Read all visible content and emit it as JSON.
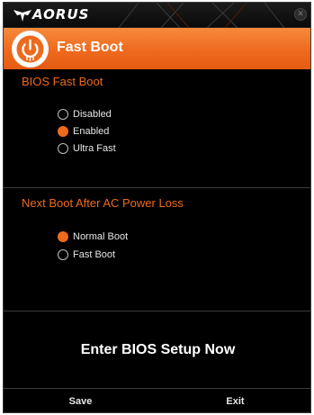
{
  "titlebar": {
    "logo_icon": "aorus-eagle-icon",
    "brand": "AORUS",
    "close_icon": "close-icon"
  },
  "header": {
    "icon": "power-icon",
    "title": "Fast Boot"
  },
  "bios_fast_boot": {
    "title": "BIOS Fast Boot",
    "options": [
      {
        "label": "Disabled",
        "selected": false
      },
      {
        "label": "Enabled",
        "selected": true
      },
      {
        "label": "Ultra Fast",
        "selected": false
      }
    ]
  },
  "next_boot": {
    "title": "Next Boot After AC Power Loss",
    "options": [
      {
        "label": "Normal Boot",
        "selected": true
      },
      {
        "label": "Fast Boot",
        "selected": false
      }
    ]
  },
  "setup": {
    "label": "Enter BIOS Setup Now"
  },
  "footer": {
    "save_label": "Save",
    "exit_label": "Exit"
  },
  "colors": {
    "accent": "#ee6a1c",
    "background": "#000000",
    "text": "#e6e6e6"
  }
}
